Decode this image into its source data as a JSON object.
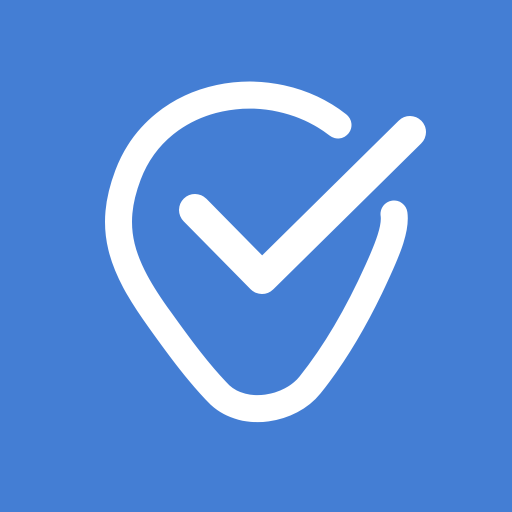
{
  "icon": {
    "name": "location-check-icon",
    "background_color": "#447ED4",
    "foreground_color": "#FFFFFF"
  }
}
